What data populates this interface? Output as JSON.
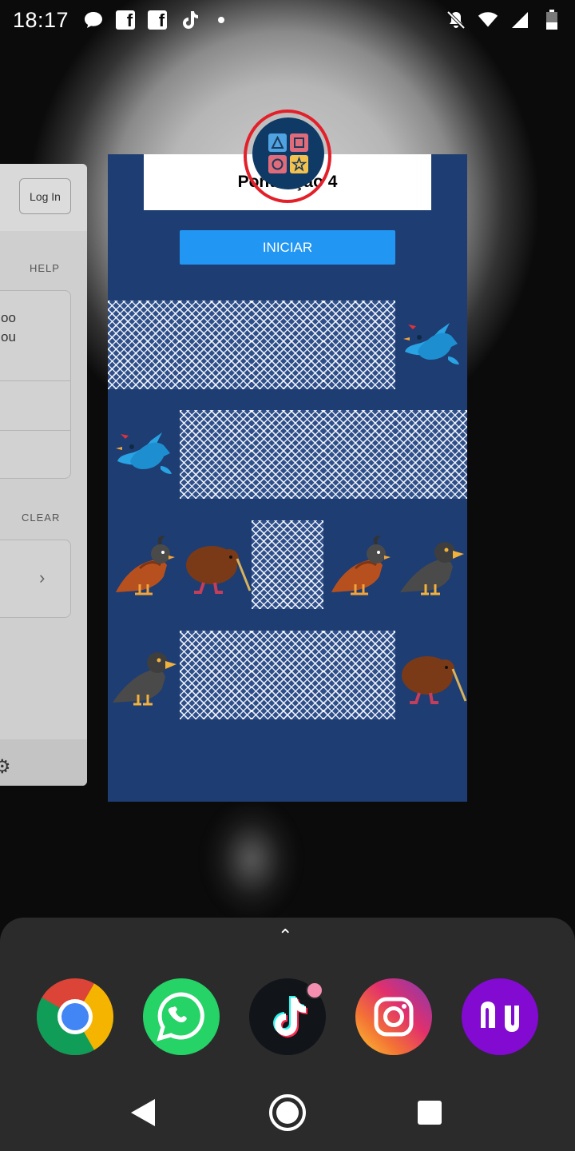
{
  "status_bar": {
    "time": "18:17",
    "notification_icons": [
      "chat-bubble-icon",
      "facebook-icon",
      "facebook-icon",
      "tiktok-icon",
      "dot-icon"
    ],
    "system_icons": [
      "do-not-disturb-bell-icon",
      "wifi-icon",
      "signal-icon",
      "battery-icon"
    ]
  },
  "left_app": {
    "login_label": "Log In",
    "help_label": "HELP",
    "text_snippet": "oo\nou",
    "clear_label": "CLEAR"
  },
  "main_app": {
    "title": "Pontuação 4",
    "start_label": "INICIAR",
    "grid": [
      [
        "covered",
        "covered",
        "covered",
        "covered",
        "blue-bird"
      ],
      [
        "blue-bird",
        "covered",
        "covered",
        "covered",
        "covered"
      ],
      [
        "quail",
        "kiwi",
        "covered",
        "quail",
        "crow"
      ],
      [
        "crow",
        "covered",
        "covered",
        "covered",
        "kiwi"
      ]
    ]
  },
  "dock": {
    "apps": [
      "chrome-icon",
      "whatsapp-icon",
      "tiktok-icon",
      "instagram-icon",
      "nubank-icon"
    ]
  },
  "colors": {
    "card_bg": "#1e3d72",
    "button_blue": "#2196f3",
    "highlight_red": "#e3202a"
  }
}
